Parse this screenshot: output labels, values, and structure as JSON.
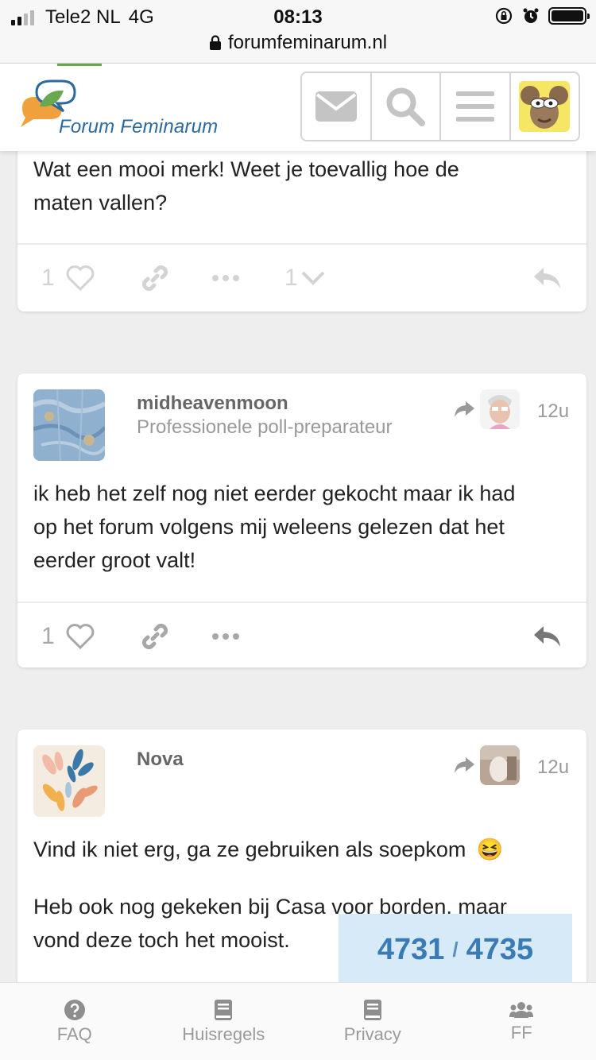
{
  "status_bar": {
    "carrier": "Tele2 NL",
    "network": "4G",
    "time": "08:13",
    "url": "forumfeminarum.nl"
  },
  "header": {
    "logo_text": "Forum Feminarum",
    "icons": [
      "mail-icon",
      "search-icon",
      "hamburger-menu-icon",
      "user-avatar"
    ]
  },
  "posts": [
    {
      "text_lines": [
        "Wat een mooi merk! Weet je toevallig hoe de",
        "maten vallen?"
      ],
      "likes": "1",
      "replies": "1"
    },
    {
      "author": "midheavenmoon",
      "user_title": "Professionele poll-preparateur",
      "time": "12u",
      "text_lines": [
        "ik heb het zelf nog niet eerder gekocht maar ik had",
        "op het forum volgens mij weleens gelezen dat het",
        "eerder groot valt!"
      ],
      "likes": "1"
    },
    {
      "author": "Nova",
      "time": "12u",
      "paragraph1": "Vind ik niet erg, ga ze gebruiken als soepkom",
      "emoji": "😆",
      "paragraph2_lines": [
        "Heb ook nog gekeken bij Casa voor borden, maar",
        "vond deze toch het mooist."
      ]
    }
  ],
  "progress": {
    "current": "4731",
    "separator": "/",
    "total": "4735"
  },
  "bottom_nav": [
    {
      "label": "FAQ",
      "icon": "question-circle-icon"
    },
    {
      "label": "Huisregels",
      "icon": "book-icon"
    },
    {
      "label": "Privacy",
      "icon": "book-icon"
    },
    {
      "label": "FF",
      "icon": "users-icon"
    }
  ],
  "colors": {
    "link_blue": "#3b7bb5",
    "progress_bg": "#d6eaf8",
    "logo_green": "#6aa84f",
    "logo_orange": "#f0a03c"
  }
}
